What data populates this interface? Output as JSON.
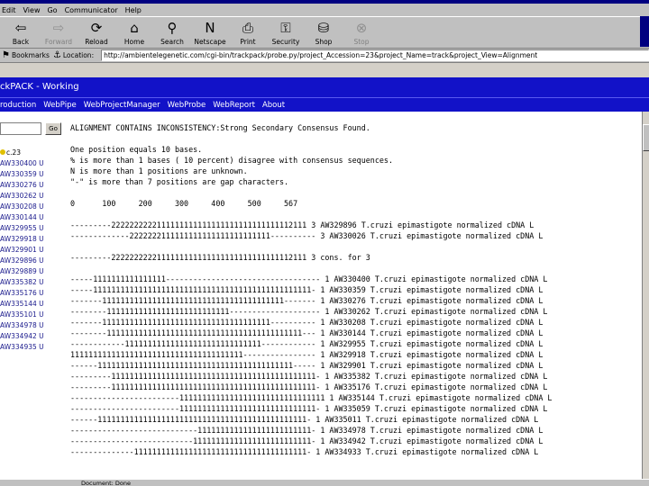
{
  "browser": {
    "menu": [
      "Edit",
      "View",
      "Go",
      "Communicator",
      "Help"
    ],
    "toolbar": [
      {
        "label": "Back",
        "icon": "back-arrow-icon",
        "glyph": "⇦",
        "enabled": true
      },
      {
        "label": "Forward",
        "icon": "forward-arrow-icon",
        "glyph": "⇨",
        "enabled": false
      },
      {
        "label": "Reload",
        "icon": "reload-icon",
        "glyph": "⟳",
        "enabled": true
      },
      {
        "label": "Home",
        "icon": "home-icon",
        "glyph": "⌂",
        "enabled": true
      },
      {
        "label": "Search",
        "icon": "search-icon",
        "glyph": "⚲",
        "enabled": true
      },
      {
        "label": "Netscape",
        "icon": "netscape-icon",
        "glyph": "N",
        "enabled": true
      },
      {
        "label": "Print",
        "icon": "print-icon",
        "glyph": "⎙",
        "enabled": true
      },
      {
        "label": "Security",
        "icon": "lock-icon",
        "glyph": "⚿",
        "enabled": true
      },
      {
        "label": "Shop",
        "icon": "shop-icon",
        "glyph": "⛁",
        "enabled": true
      },
      {
        "label": "Stop",
        "icon": "stop-icon",
        "glyph": "⊗",
        "enabled": false
      }
    ],
    "bookmarks_label": "Bookmarks",
    "location_label": "Location:",
    "url": "http://ambientelegenetic.com/cgi-bin/trackpack/probe.py/project_Accession=23&project_Name=track&project_View=Alignment"
  },
  "app": {
    "title": "ckPACK - Working",
    "menu": [
      "roduction",
      "WebPipe",
      "WebProjectManager",
      "WebProbe",
      "WebReport",
      "About"
    ],
    "go_label": "Go",
    "tree_root": "c.23",
    "tree_items": [
      "AW330400 U",
      "AW330359 U",
      "AW330276 U",
      "AW330262 U",
      "AW330208 U",
      "AW330144 U",
      "AW329955 U",
      "AW329918 U",
      "AW329901 U",
      "AW329896 U",
      "AW329889 U",
      "AW335382 U",
      "AW335176 U",
      "AW335144 U",
      "AW335101 U",
      "AW334978 U",
      "AW334942 U",
      "AW334935 U"
    ]
  },
  "alignment": {
    "lines": [
      "ALIGNMENT CONTAINS INCONSISTENCY:Strong Secondary Consensus Found.",
      "",
      "One position equals 10 bases.",
      "% is more than 1 bases ( 10 percent) disagree with consensus sequences.",
      "N is more than 1 positions are unknown.",
      "\"-\" is more than 7 positions are gap characters.",
      "",
      "0      100     200     300     400     500     567",
      "",
      "---------2222222222111111111111111111111111111112111 3 AW329896 T.cruzi epimastigote normalized cDNA L",
      "-------------2222222111111111111111111111111---------- 3 AW330026 T.cruzi epimastigote normalized cDNA L",
      "",
      "---------2222222222111111111111111111111111111112111 3 cons. for 3",
      "",
      "-----1111111111111111---------------------------------- 1 AW330400 T.cruzi epimastigote normalized cDNA L",
      "-----111111111111111111111111111111111111111111111111- 1 AW330359 T.cruzi epimastigote normalized cDNA L",
      "-------1111111111111111111111111111111111111111------- 1 AW330276 T.cruzi epimastigote normalized cDNA L",
      "--------111111111111111111111111111-------------------- 1 AW330262 T.cruzi epimastigote normalized cDNA L",
      "-------1111111111111111111111111111111111111---------- 1 AW330208 T.cruzi epimastigote normalized cDNA L",
      "--------1111111111111111111111111111111111111111111--- 1 AW330144 T.cruzi epimastigote normalized cDNA L",
      "------------111111111111111111111111111111------------ 1 AW329955 T.cruzi epimastigote normalized cDNA L",
      "11111111111111111111111111111111111111---------------- 1 AW329918 T.cruzi epimastigote normalized cDNA L",
      "------1111111111111111111111111111111111111111111----- 1 AW329901 T.cruzi epimastigote normalized cDNA L",
      "---------111111111111111111111111111111111111111111111- 1 AW335382 T.cruzi epimastigote normalized cDNA L",
      "---------111111111111111111111111111111111111111111111- 1 AW335176 T.cruzi epimastigote normalized cDNA L",
      "------------------------11111111111111111111111111111111 1 AW335144 T.cruzi epimastigote normalized cDNA L",
      "------------------------111111111111111111111111111111- 1 AW335059 T.cruzi epimastigote normalized cDNA L",
      "------1111111111111111111111111111111111111111111111- 1 AW335011 T.cruzi epimastigote normalized cDNA L",
      "----------------------------1111111111111111111111111- 1 AW334978 T.cruzi epimastigote normalized cDNA L",
      "---------------------------11111111111111111111111111- 1 AW334942 T.cruzi epimastigote normalized cDNA L",
      "--------------11111111111111111111111111111111111111- 1 AW334933 T.cruzi epimastigote normalized cDNA L"
    ]
  },
  "status": "Document: Done"
}
